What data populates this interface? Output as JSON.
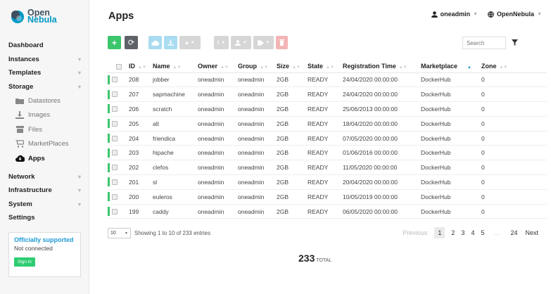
{
  "brand": {
    "line1": "Open",
    "line2": "Nebula"
  },
  "sidebar": {
    "items": [
      {
        "label": "Dashboard",
        "chevron": false
      },
      {
        "label": "Instances",
        "chevron": true
      },
      {
        "label": "Templates",
        "chevron": true
      },
      {
        "label": "Storage",
        "chevron": true
      }
    ],
    "storage_sub": [
      {
        "label": "Datastores",
        "icon": "folder-icon"
      },
      {
        "label": "Images",
        "icon": "download-icon"
      },
      {
        "label": "Files",
        "icon": "file-icon"
      },
      {
        "label": "MarketPlaces",
        "icon": "cart-icon"
      },
      {
        "label": "Apps",
        "icon": "cloud-icon",
        "active": true
      }
    ],
    "items2": [
      {
        "label": "Network",
        "chevron": true
      },
      {
        "label": "Infrastructure",
        "chevron": true
      },
      {
        "label": "System",
        "chevron": true
      },
      {
        "label": "Settings",
        "chevron": false
      }
    ],
    "support": {
      "title": "Officially supported",
      "status": "Not connected",
      "signin": "Sign in"
    }
  },
  "header": {
    "title": "Apps",
    "user": "oneadmin",
    "zone": "OpenNebula"
  },
  "toolbar": {
    "search_placeholder": "Search"
  },
  "table": {
    "columns": [
      "ID",
      "Name",
      "Owner",
      "Group",
      "Size",
      "State",
      "Registration Time",
      "Marketplace",
      "Zone"
    ],
    "rows": [
      [
        "208",
        "jobber",
        "oneadmin",
        "oneadmin",
        "2GB",
        "READY",
        "24/04/2020 00:00:00",
        "DockerHub",
        "0"
      ],
      [
        "207",
        "sapmachine",
        "oneadmin",
        "oneadmin",
        "2GB",
        "READY",
        "24/04/2020 00:00:00",
        "DockerHub",
        "0"
      ],
      [
        "206",
        "scratch",
        "oneadmin",
        "oneadmin",
        "2GB",
        "READY",
        "25/06/2013 00:00:00",
        "DockerHub",
        "0"
      ],
      [
        "205",
        "alt",
        "oneadmin",
        "oneadmin",
        "2GB",
        "READY",
        "18/04/2020 00:00:00",
        "DockerHub",
        "0"
      ],
      [
        "204",
        "friendica",
        "oneadmin",
        "oneadmin",
        "2GB",
        "READY",
        "07/05/2020 00:00:00",
        "DockerHub",
        "0"
      ],
      [
        "203",
        "hipache",
        "oneadmin",
        "oneadmin",
        "2GB",
        "READY",
        "01/06/2016 00:00:00",
        "DockerHub",
        "0"
      ],
      [
        "202",
        "clefos",
        "oneadmin",
        "oneadmin",
        "2GB",
        "READY",
        "11/05/2020 00:00:00",
        "DockerHub",
        "0"
      ],
      [
        "201",
        "sl",
        "oneadmin",
        "oneadmin",
        "2GB",
        "READY",
        "20/04/2020 00:00:00",
        "DockerHub",
        "0"
      ],
      [
        "200",
        "euleros",
        "oneadmin",
        "oneadmin",
        "2GB",
        "READY",
        "10/05/2019 00:00:00",
        "DockerHub",
        "0"
      ],
      [
        "199",
        "caddy",
        "oneadmin",
        "oneadmin",
        "2GB",
        "READY",
        "06/05/2020 00:00:00",
        "DockerHub",
        "0"
      ]
    ]
  },
  "footer": {
    "page_size": "10",
    "info": "Showing 1 to 10 of 233 entries",
    "previous": "Previous",
    "pages": [
      "1",
      "2",
      "3",
      "4",
      "5"
    ],
    "ellipsis": "…",
    "last": "24",
    "next": "Next",
    "total_count": "233",
    "total_label": "TOTAL"
  },
  "colors": {
    "accent": "#1e9bd6",
    "create": "#3bc66b",
    "status_ready": "#3bc66b"
  }
}
